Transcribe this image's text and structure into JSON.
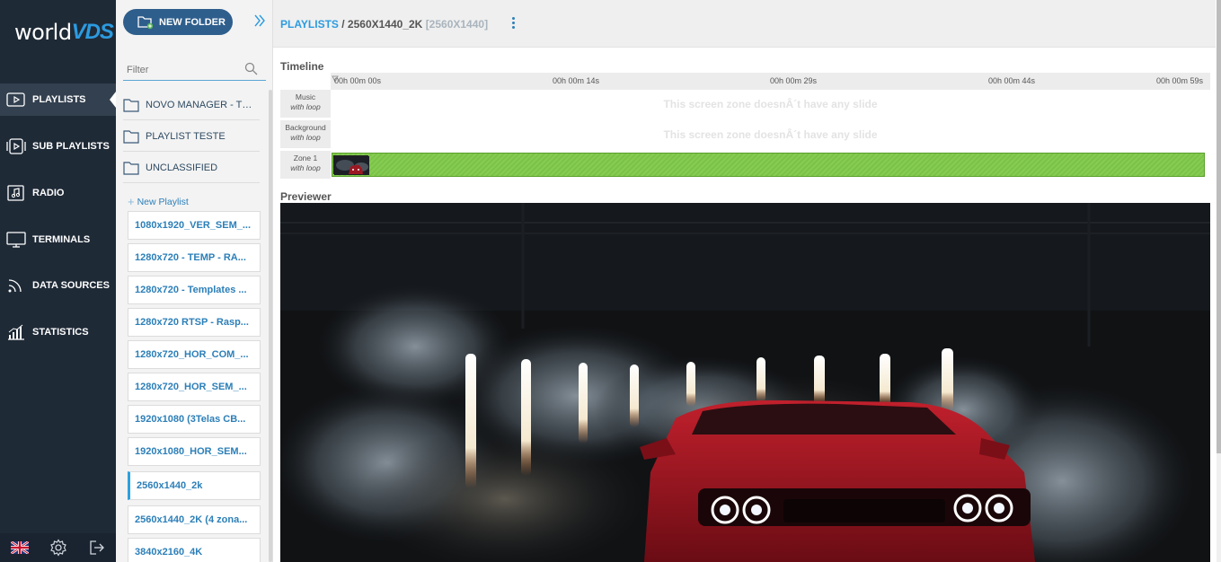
{
  "app": {
    "logo_part1": "world",
    "logo_part2": "VDS"
  },
  "nav": {
    "items": [
      {
        "label": "PLAYLISTS",
        "icon": "playlist-icon"
      },
      {
        "label": "SUB PLAYLISTS",
        "icon": "sub-playlist-icon"
      },
      {
        "label": "RADIO",
        "icon": "radio-icon"
      },
      {
        "label": "TERMINALS",
        "icon": "monitor-icon"
      },
      {
        "label": "DATA SOURCES",
        "icon": "feed-icon"
      },
      {
        "label": "STATISTICS",
        "icon": "bar-chart-icon"
      }
    ],
    "active": "PLAYLISTS",
    "bottom_icons": [
      "uk-flag-icon",
      "gear-icon",
      "logout-icon"
    ]
  },
  "sidebar": {
    "new_folder_label": "NEW FOLDER",
    "filter_placeholder": "Filter",
    "filter_value": "",
    "folders": [
      "NOVO MANAGER - TESTE",
      "PLAYLIST TESTE",
      "UNCLASSIFIED"
    ],
    "new_playlist_label": "New Playlist",
    "playlists": [
      "1080x1920_VER_SEM_...",
      "1280x720 - TEMP - RA...",
      "1280x720 - Templates ...",
      "1280x720 RTSP - Rasp...",
      "1280x720_HOR_COM_...",
      "1280x720_HOR_SEM_...",
      "1920x1080 (3Telas CB...",
      "1920x1080_HOR_SEM...",
      "2560x1440_2k",
      "2560x1440_2K (4 zona...",
      "3840x2160_4K"
    ],
    "active_playlist": "2560x1440_2k"
  },
  "breadcrumb": {
    "root": "PLAYLISTS",
    "separator": " / ",
    "current": "2560X1440_2K",
    "resolution": "[2560X1440]"
  },
  "timeline": {
    "title": "Timeline",
    "ticks": [
      "00h 00m 00s",
      "00h 00m 14s",
      "00h 00m 29s",
      "00h 00m 44s",
      "00h 00m 59s"
    ],
    "rows": [
      {
        "name": "Music",
        "loop": "with loop",
        "empty_text": "This screen zone doesnÂ´t have any slide"
      },
      {
        "name": "Background",
        "loop": "with loop",
        "empty_text": "This screen zone doesnÂ´t have any slide"
      },
      {
        "name": "Zone 1",
        "loop": "with loop"
      }
    ]
  },
  "previewer": {
    "title": "Previewer"
  },
  "colors": {
    "nav_bg": "#1f2a37",
    "accent": "#2c9be0",
    "new_folder_bg": "#2e5e8c",
    "zone_green": "#86cc52"
  }
}
